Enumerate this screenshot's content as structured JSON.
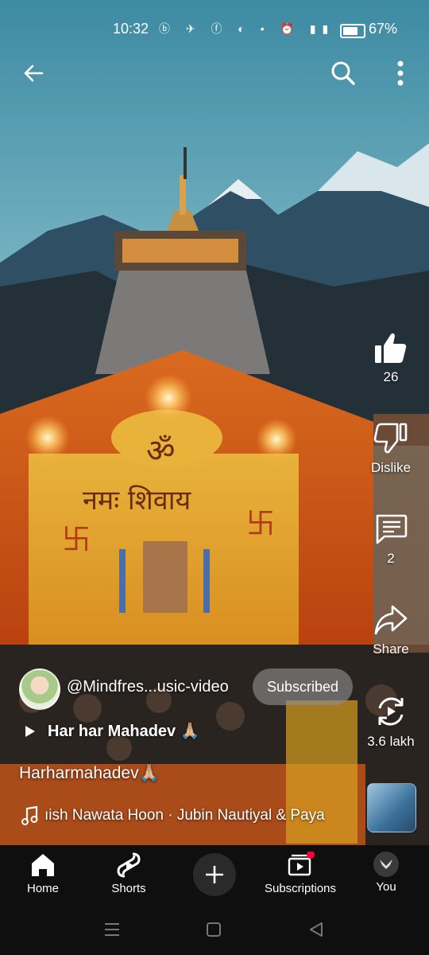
{
  "status_bar": {
    "time": "10:32",
    "battery_percent": "67%"
  },
  "video": {
    "likes": "26",
    "dislike_label": "Dislike",
    "comments": "2",
    "share_label": "Share",
    "remix_count": "3.6 lakh"
  },
  "channel": {
    "handle": "@Mindfres...usic-video",
    "subscribe_label": "Subscribed"
  },
  "video_title": "Har har Mahadev 🙏🏼",
  "hashtag_caption": "Harharmahadev🙏🏼",
  "music": {
    "track": "ıish Nawata Hoon · Jubin Nautiyal & Paya"
  },
  "nav": {
    "home": "Home",
    "shorts": "Shorts",
    "subscriptions": "Subscriptions",
    "you": "You"
  },
  "colors": {
    "nav_bg": "#0f0f0f",
    "notification_dot": "#ff0033",
    "temple_marigold": "#e8641a"
  }
}
